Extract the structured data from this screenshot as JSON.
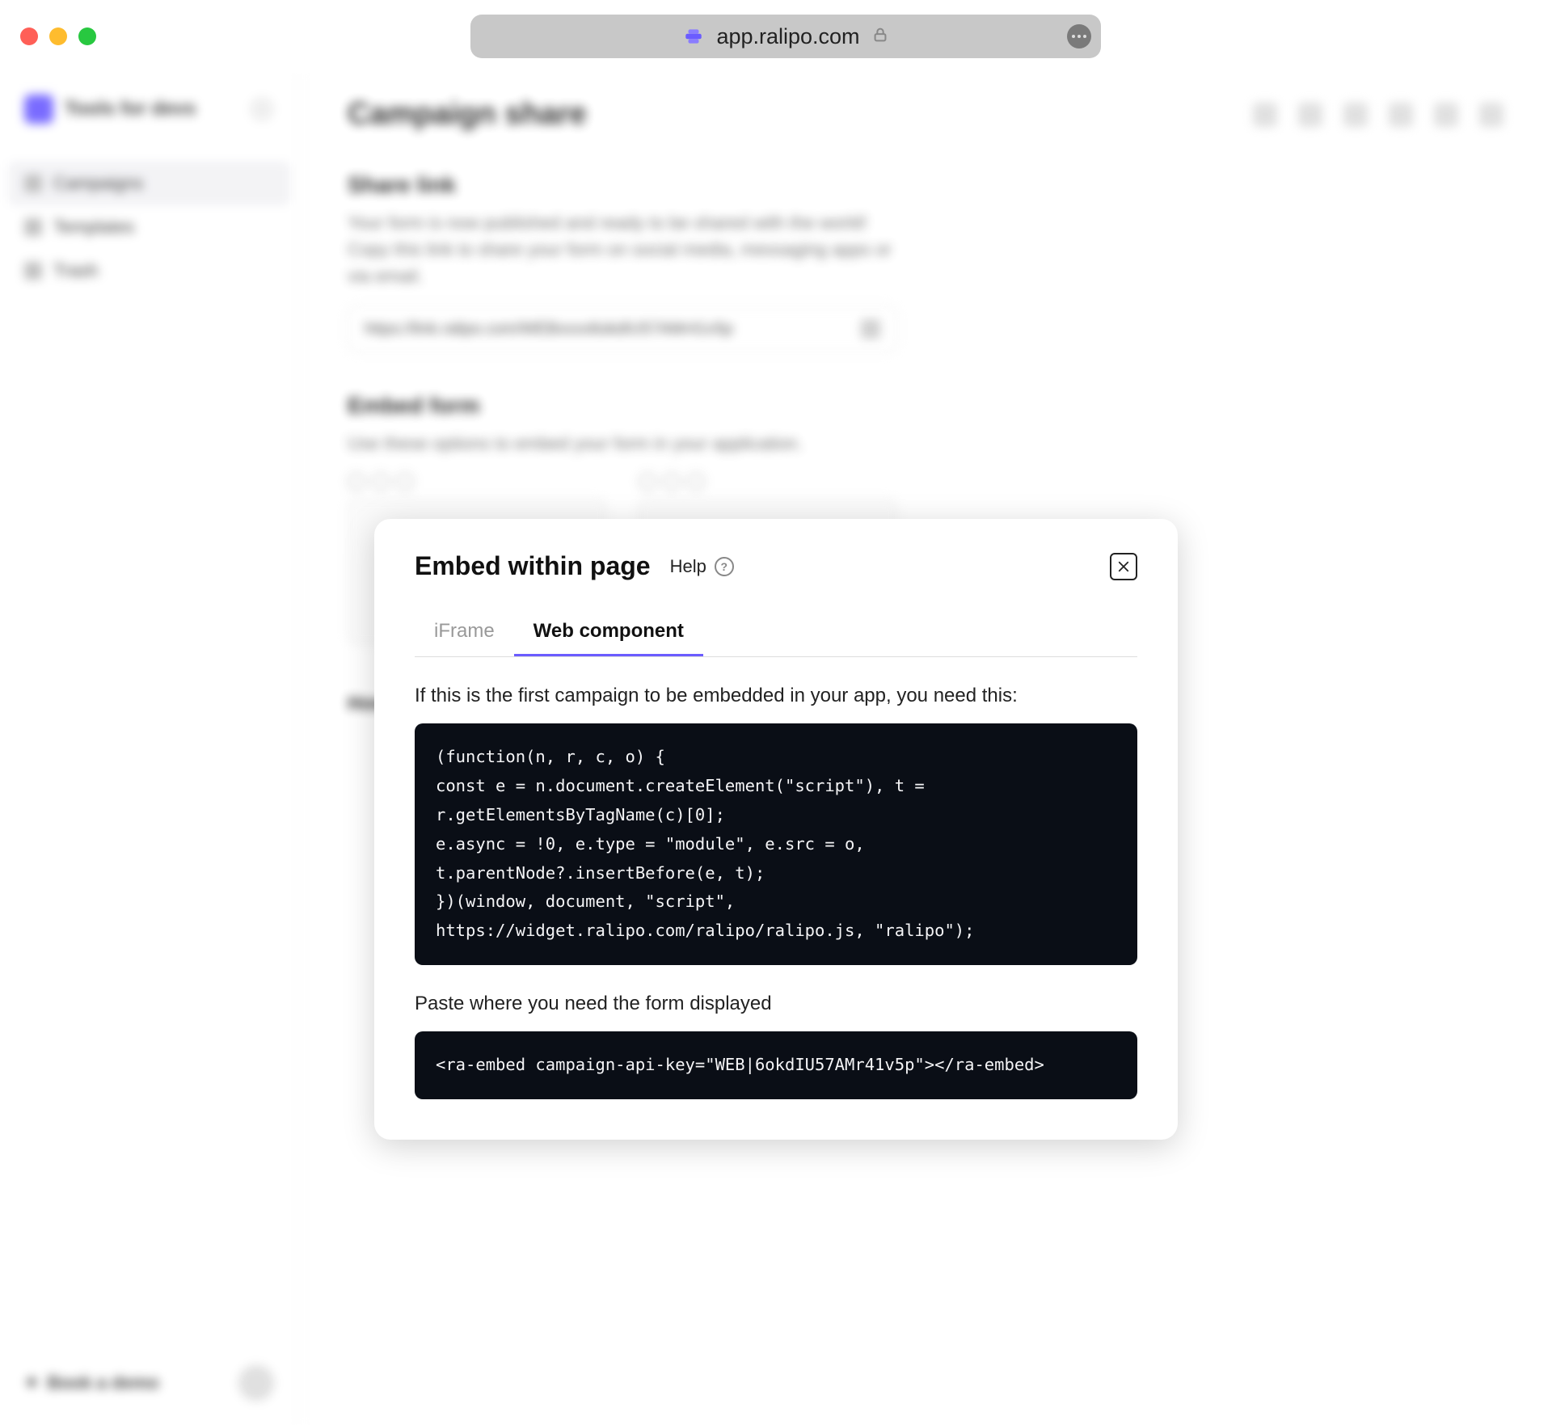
{
  "browser": {
    "url": "app.ralipo.com"
  },
  "sidebar": {
    "brand": "Tools for devs",
    "items": [
      {
        "label": "Campaigns"
      },
      {
        "label": "Templates"
      },
      {
        "label": "Trash"
      }
    ],
    "book_demo": "Book a demo"
  },
  "main": {
    "title": "Campaign share",
    "share": {
      "title": "Share link",
      "desc": "Your form is now published and ready to be shared with the world! Copy this link to share your form on social media, messaging apps or via email.",
      "url": "https://link.ralipo.com/WEBxxxx6okdIU57AMr41v5p"
    },
    "embed": {
      "title": "Embed form",
      "desc": "Use these options to embed your form in your application."
    },
    "howto": "How to embed"
  },
  "modal": {
    "title": "Embed within page",
    "help": "Help",
    "tabs": {
      "iframe": "iFrame",
      "web_component": "Web component"
    },
    "note1": "If this is the first campaign to be embedded in your app, you need this:",
    "code1": "(function(n, r, c, o) {\nconst e = n.document.createElement(\"script\"), t = r.getElementsByTagName(c)[0];\ne.async = !0, e.type = \"module\", e.src = o, t.parentNode?.insertBefore(e, t);\n})(window, document, \"script\", https://widget.ralipo.com/ralipo/ralipo.js, \"ralipo\");",
    "note2": "Paste where you need the form displayed",
    "code2": "<ra-embed campaign-api-key=\"WEB|6okdIU57AMr41v5p\"></ra-embed>"
  }
}
